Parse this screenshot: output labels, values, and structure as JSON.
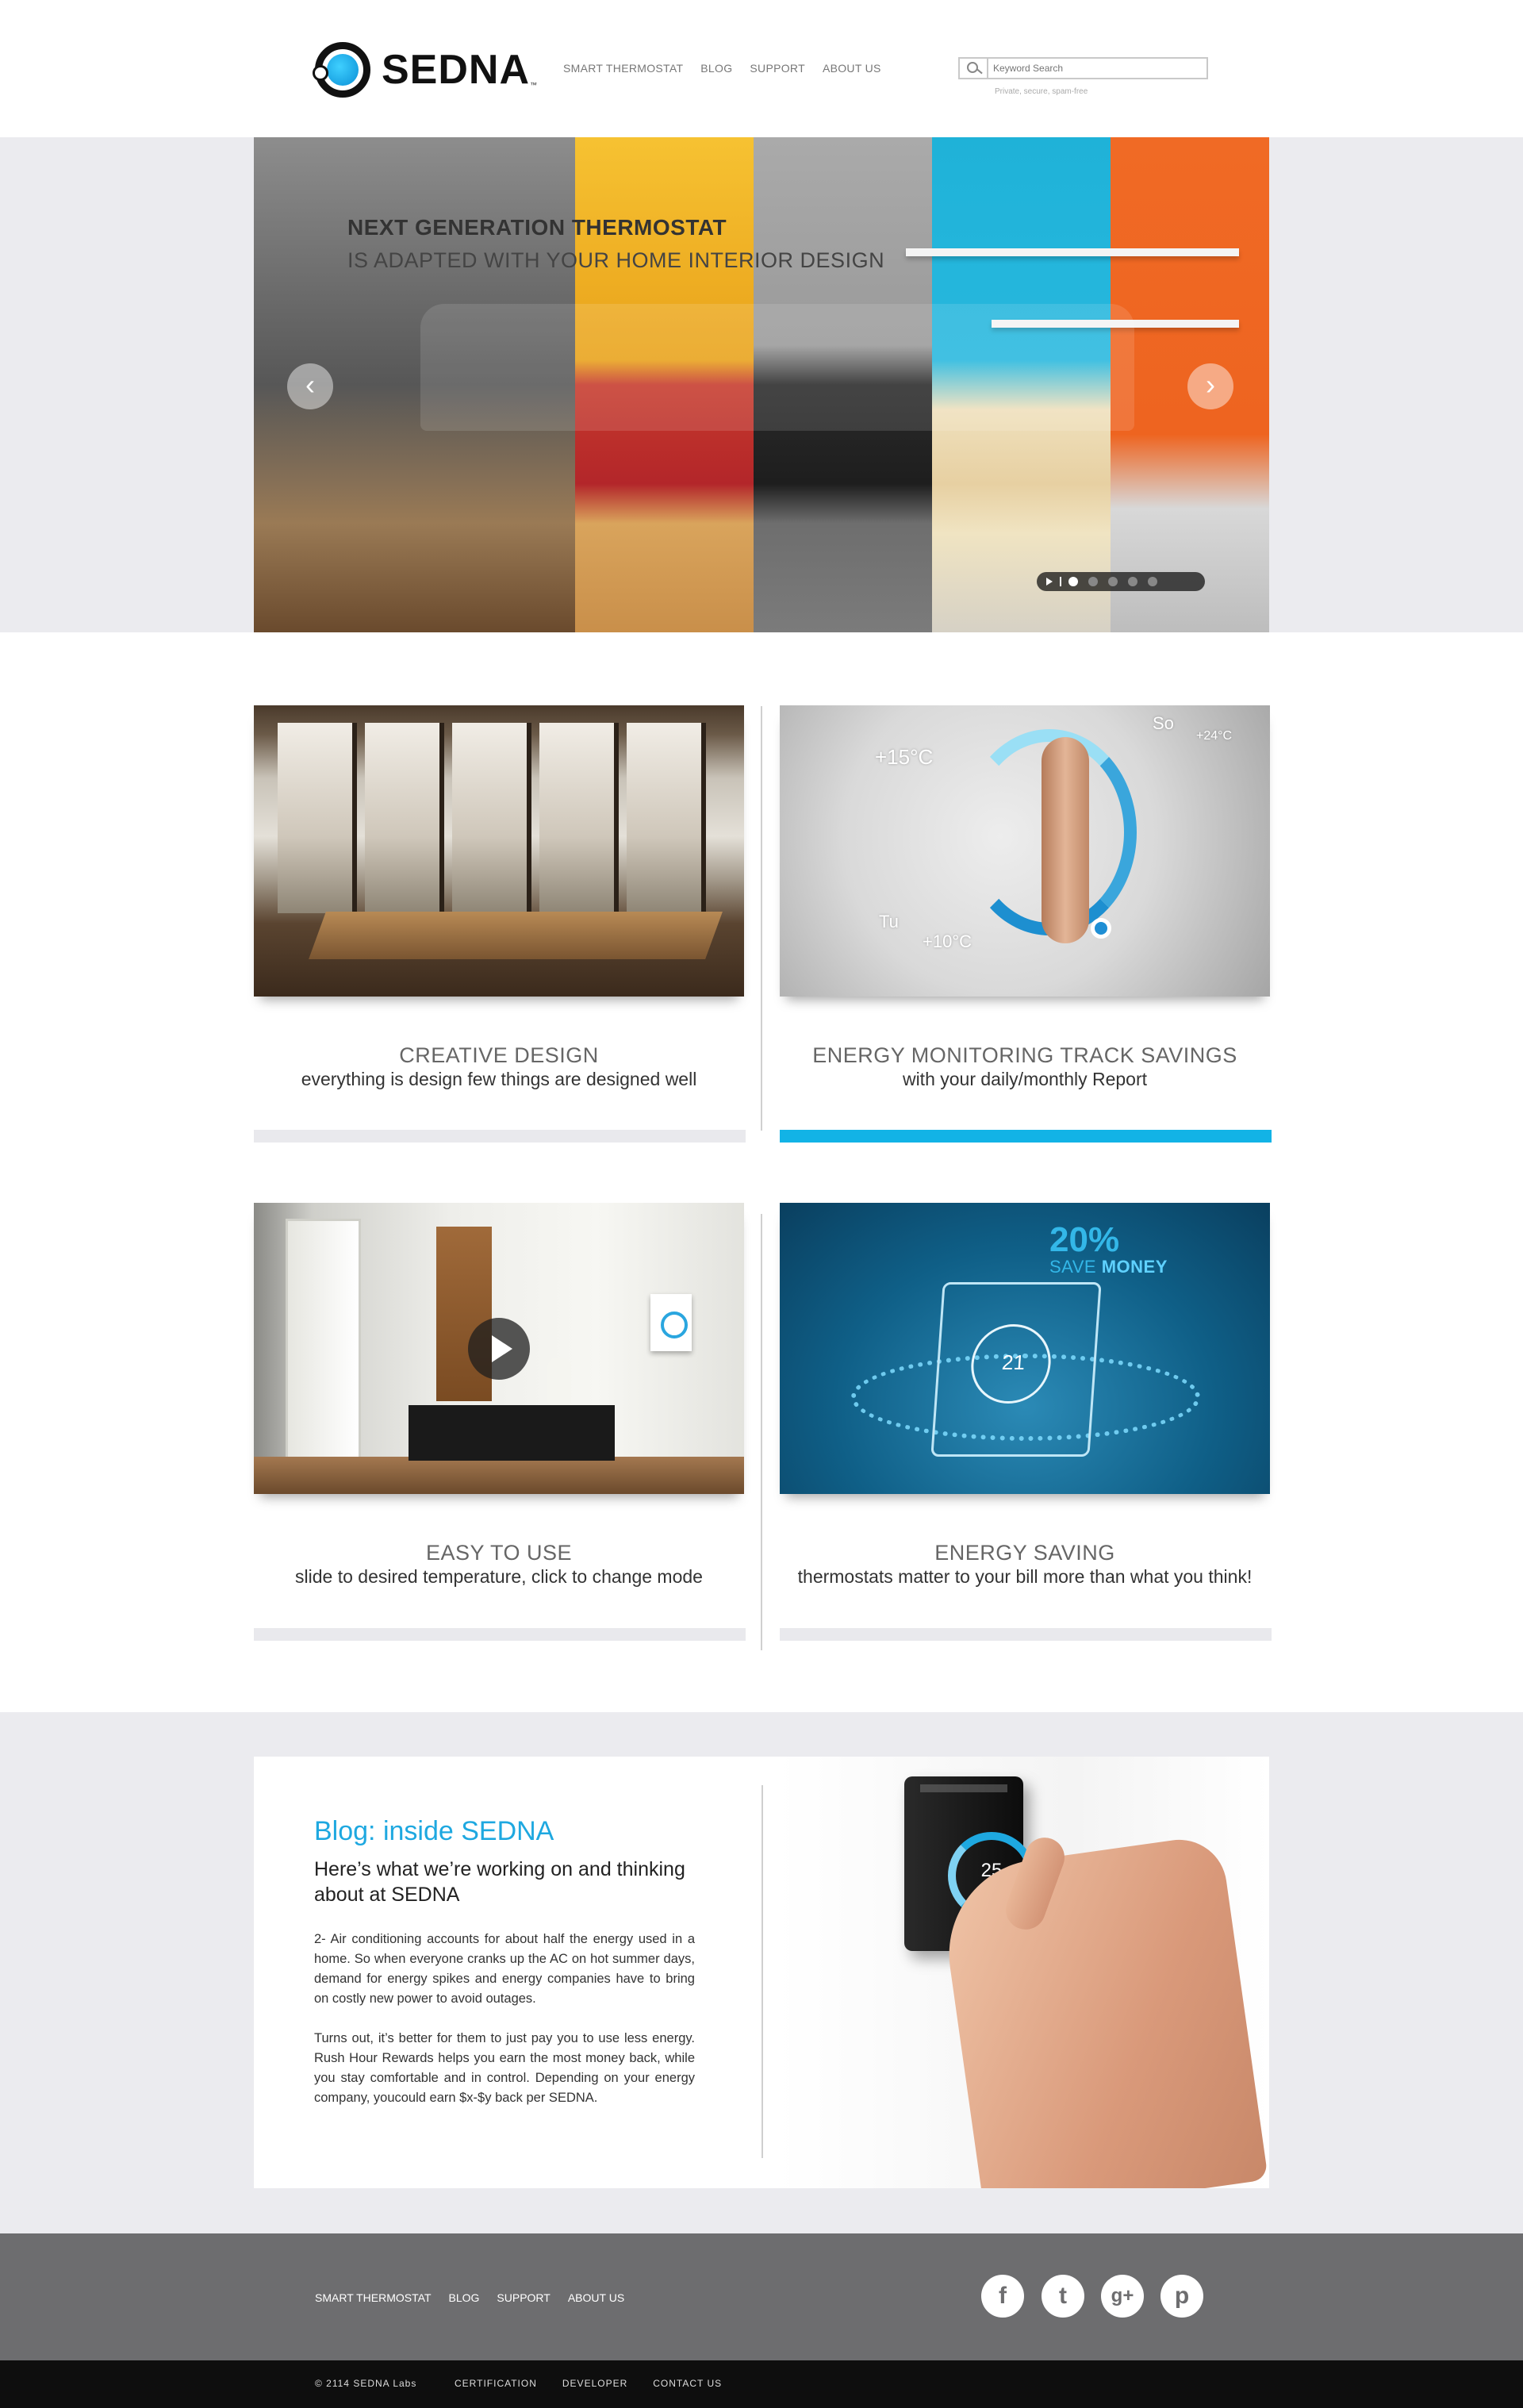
{
  "header": {
    "logo_text": "SEDNA",
    "logo_tm": "™",
    "nav": [
      "SMART THERMOSTAT",
      "BLOG",
      "SUPPORT",
      "ABOUT US"
    ],
    "search_placeholder": "Keyword Search",
    "search_note": "Private, secure, spam-free"
  },
  "hero": {
    "title": "NEXT GENERATION THERMOSTAT",
    "subtitle": "IS ADAPTED WITH YOUR HOME INTERIOR DESIGN",
    "prev_icon": "chevron-left-icon",
    "next_icon": "chevron-right-icon",
    "slide_count": 5,
    "active_slide": 1
  },
  "features": [
    {
      "title": "CREATIVE DESIGN",
      "subtitle": "everything is design few things are designed well",
      "active": false
    },
    {
      "title": "ENERGY MONITORING TRACK SAVINGS",
      "subtitle": "with your daily/monthly Report",
      "active": true,
      "overlay": {
        "temp_high": "+15°C",
        "temp_low": "+10°C",
        "temp_right": "+24°C",
        "day_a": "So",
        "day_b": "Tu"
      }
    },
    {
      "title": "EASY TO USE",
      "subtitle": "slide to desired temperature, click to change mode",
      "active": false
    },
    {
      "title": "ENERGY SAVING",
      "subtitle": "thermostats matter to your bill more than what you think!",
      "active": false,
      "overlay": {
        "percent": "20%",
        "save": "SAVE",
        "money": "MONEY",
        "device_temp": "21"
      }
    }
  ],
  "blog": {
    "title": "Blog: inside SEDNA",
    "lead": "Here’s what we’re working on and thinking about at SEDNA",
    "paragraph1": "2- Air conditioning accounts for about half the energy used in a home. So when everyone cranks up the AC on hot summer days, demand for energy spikes and energy companies have to bring on costly new power to avoid outages.",
    "paragraph2": "Turns out, it’s better for them to just pay you to use less energy. Rush Hour Rewards helps you earn the most money back, while you stay comfortable and in control. Depending on your energy company, youcould earn $x-$y back per SEDNA.",
    "device_temp": "25"
  },
  "footer": {
    "nav": [
      "SMART THERMOSTAT",
      "BLOG",
      "SUPPORT",
      "ABOUT US"
    ],
    "social": [
      {
        "name": "facebook-icon",
        "glyph": "f"
      },
      {
        "name": "twitter-icon",
        "glyph": "t"
      },
      {
        "name": "google-plus-icon",
        "glyph": "g+"
      },
      {
        "name": "pinterest-icon",
        "glyph": "p"
      }
    ],
    "copyright": "© 2114 SEDNA Labs",
    "bottom_nav": [
      "CERTIFICATION",
      "DEVELOPER",
      "CONTACT US"
    ]
  },
  "colors": {
    "accent": "#12b3e6",
    "footer": "#6d6d6f",
    "bottom": "#0e0e0e",
    "band": "#ebebef"
  }
}
